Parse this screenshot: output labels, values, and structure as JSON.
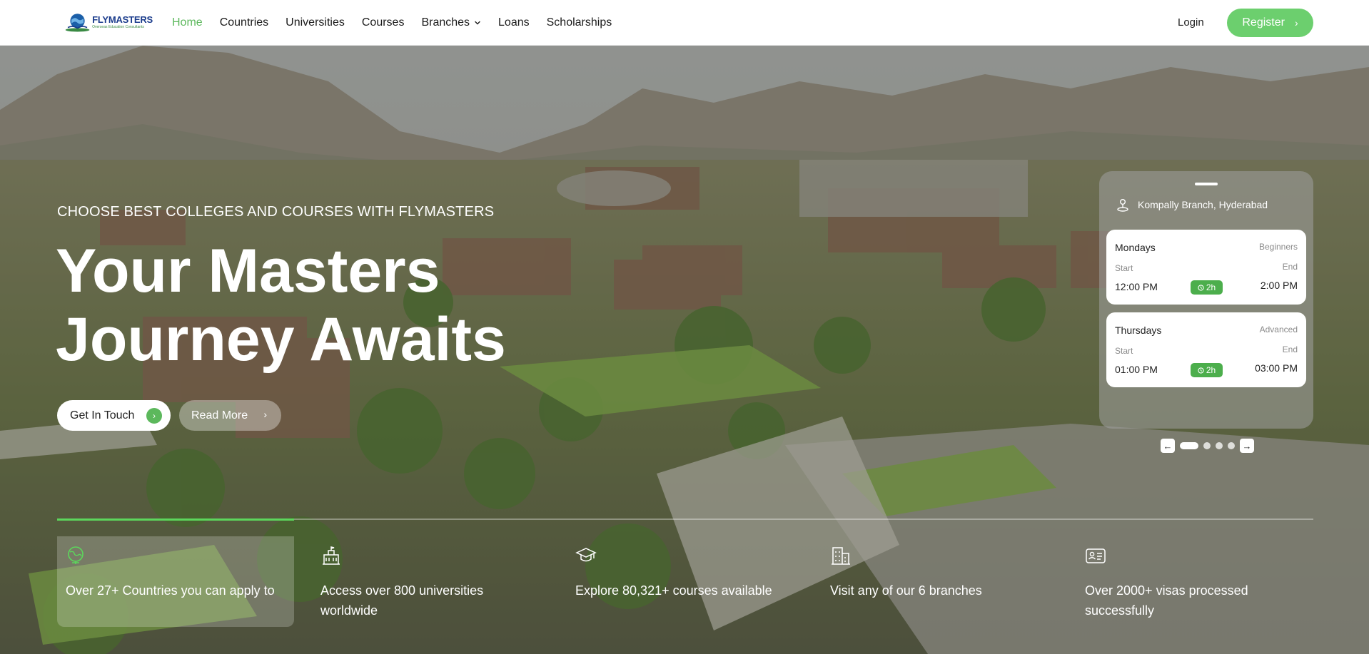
{
  "nav": {
    "logo_text": "FLYMASTERS",
    "logo_subtext": "Overseas Education Consultants",
    "items": [
      {
        "label": "Home",
        "active": true
      },
      {
        "label": "Countries"
      },
      {
        "label": "Universities"
      },
      {
        "label": "Courses"
      },
      {
        "label": "Branches",
        "has_dropdown": true
      },
      {
        "label": "Loans"
      },
      {
        "label": "Scholarships"
      }
    ],
    "login_label": "Login",
    "register_label": "Register"
  },
  "hero": {
    "kicker": "CHOOSE BEST COLLEGES AND COURSES WITH FLYMASTERS",
    "headline_line1": "Your Masters",
    "headline_line2": "Journey Awaits",
    "cta_primary": "Get In Touch",
    "cta_secondary": "Read More"
  },
  "schedule": {
    "location": "Kompally Branch, Hyderabad",
    "cards": [
      {
        "day": "Mondays",
        "level": "Beginners",
        "start_label": "Start",
        "end_label": "End",
        "start_time": "12:00 PM",
        "end_time": "2:00 PM",
        "duration": "2h"
      },
      {
        "day": "Thursdays",
        "level": "Advanced",
        "start_label": "Start",
        "end_label": "End",
        "start_time": "01:00 PM",
        "end_time": "03:00 PM",
        "duration": "2h"
      }
    ],
    "pager": {
      "count": 4,
      "active": 1
    }
  },
  "stats": [
    {
      "icon": "globe-icon",
      "text": "Over 27+ Countries you can apply to"
    },
    {
      "icon": "university-building-icon",
      "text": "Access over 800 universities worldwide"
    },
    {
      "icon": "graduation-cap-icon",
      "text": "Explore 80,321+ courses available"
    },
    {
      "icon": "office-building-icon",
      "text": "Visit any of our 6 branches"
    },
    {
      "icon": "id-card-icon",
      "text": "Over 2000+ visas processed successfully"
    }
  ],
  "colors": {
    "accent_green": "#5cb85c",
    "register_green": "#6ccf6e",
    "nav_text": "#1a1a1a",
    "logo_blue": "#1b3c8c"
  }
}
